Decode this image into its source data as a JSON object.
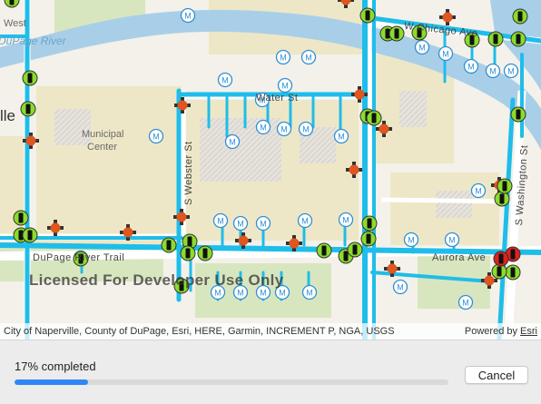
{
  "map": {
    "labels": {
      "west": "West",
      "river": "DuPage River",
      "chicago_ave": "W Chicago Ave",
      "water_st": "Water St",
      "municipal": "Municipal",
      "center": "Center",
      "webster": "S Webster St",
      "washington": "S Washington St",
      "river_trail": "DuPage River Trail",
      "aurora_ave": "Aurora Ave",
      "ille": "lle"
    },
    "watermark": "Licensed For Developer Use Only",
    "attribution": "City of Naperville, County of DuPage, Esri, HERE, Garmin, INCREMENT P, NGA, USGS",
    "powered_by_prefix": "Powered by ",
    "powered_by_link": "Esri",
    "colors": {
      "road": "#f7f7f4",
      "river": "#a9cfe8",
      "park": "#d8e6c0",
      "block": "#ede7c7",
      "pipe": "#1fbde9",
      "valve": "#8bdc2a",
      "hydrant": "#e0561f",
      "meter_outline": "#2e8fd6",
      "alert": "#e0201d"
    },
    "icons": {
      "meter": "meter-icon",
      "valve": "valve-icon",
      "hydrant": "hydrant-icon"
    }
  },
  "progress": {
    "label": "17% completed",
    "fraction": 0.17,
    "cancel_label": "Cancel"
  }
}
